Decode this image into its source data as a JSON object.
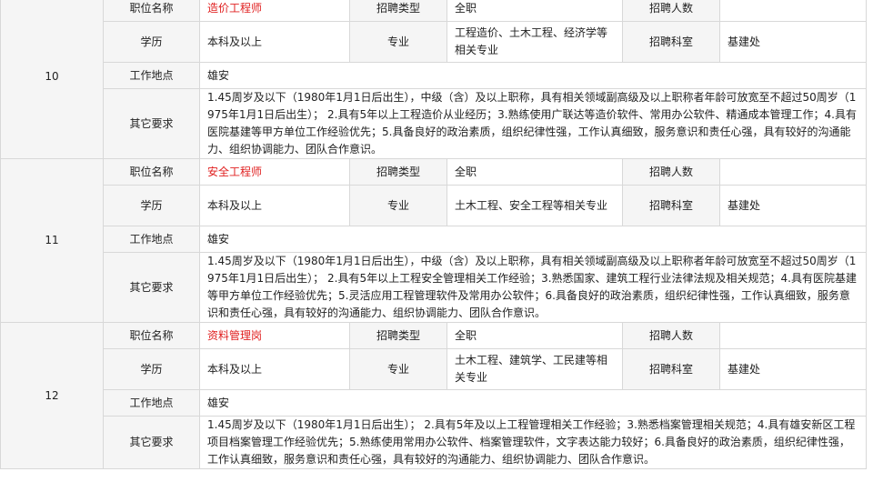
{
  "labels": {
    "position": "职位名称",
    "type": "招聘类型",
    "count": "招聘人数",
    "education": "学历",
    "major": "专业",
    "department": "招聘科室",
    "location": "工作地点",
    "other": "其它要求"
  },
  "jobs": [
    {
      "no": "10",
      "position": "造价工程师",
      "type": "全职",
      "count": "",
      "education": "本科及以上",
      "major": "工程造价、土木工程、经济学等相关专业",
      "department": "基建处",
      "location": "雄安",
      "requirements": "1.45周岁及以下（1980年1月1日后出生），中级（含）及以上职称，具有相关领域副高级及以上职称者年龄可放宽至不超过50周岁（1975年1月1日后出生）； 2.具有5年以上工程造价从业经历；3.熟练使用广联达等造价软件、常用办公软件、精通成本管理工作；4.具有医院基建等甲方单位工作经验优先；5.具备良好的政治素质，组织纪律性强，工作认真细致，服务意识和责任心强，具有较好的沟通能力、组织协调能力、团队合作意识。"
    },
    {
      "no": "11",
      "position": "安全工程师",
      "type": "全职",
      "count": "",
      "education": "本科及以上",
      "major": "土木工程、安全工程等相关专业",
      "department": "基建处",
      "location": "雄安",
      "requirements": "1.45周岁及以下（1980年1月1日后出生），中级（含）及以上职称，具有相关领域副高级及以上职称者年龄可放宽至不超过50周岁（1975年1月1日后出生）； 2.具有5年以上工程安全管理相关工作经验；3.熟悉国家、建筑工程行业法律法规及相关规范；4.具有医院基建等甲方单位工作经验优先；5.灵活应用工程管理软件及常用办公软件；6.具备良好的政治素质，组织纪律性强，工作认真细致，服务意识和责任心强，具有较好的沟通能力、组织协调能力、团队合作意识。"
    },
    {
      "no": "12",
      "position": "资料管理岗",
      "type": "全职",
      "count": "",
      "education": "本科及以上",
      "major": "土木工程、建筑学、工民建等相关专业",
      "department": "基建处",
      "location": "雄安",
      "requirements": "1.45周岁及以下（1980年1月1日后出生）； 2.具有5年及以上工程管理相关工作经验；3.熟悉档案管理相关规范；4.具有雄安新区工程项目档案管理工作经验优先；5.熟练使用常用办公软件、档案管理软件，文字表达能力较好；6.具备良好的政治素质，组织纪律性强，工作认真细致，服务意识和责任心强，具有较好的沟通能力、组织协调能力、团队合作意识。"
    }
  ]
}
